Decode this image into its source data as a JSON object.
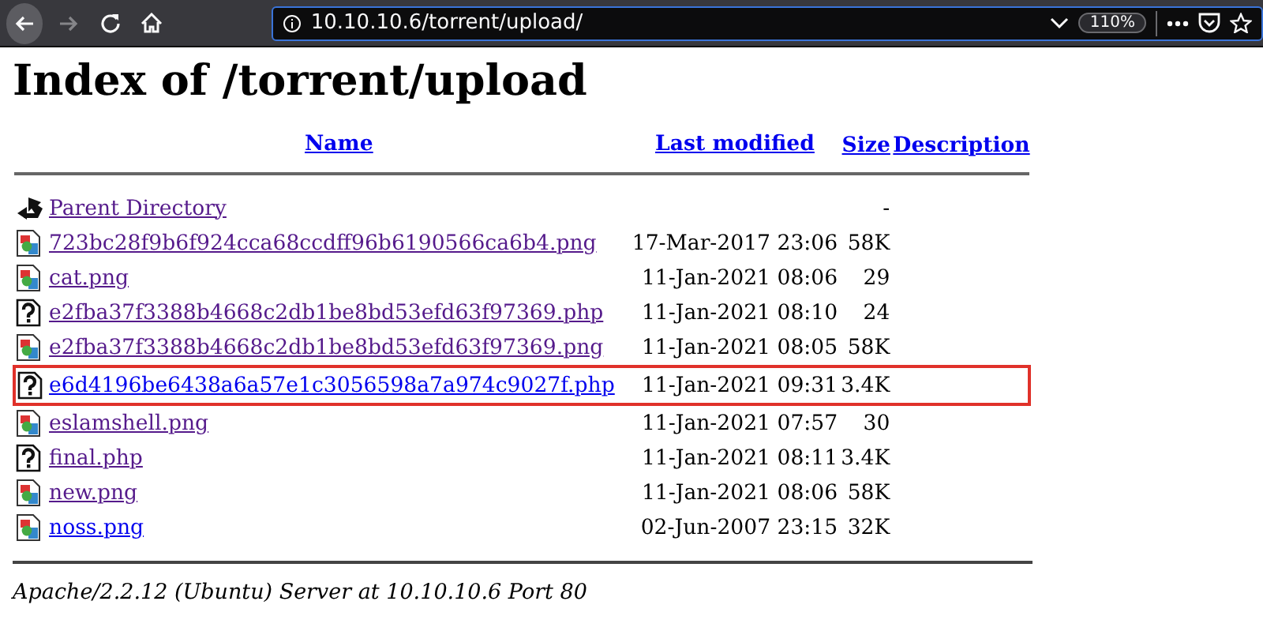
{
  "toolbar": {
    "back_enabled": true,
    "forward_enabled": false,
    "url": "10.10.10.6/torrent/upload/",
    "zoom": "110%"
  },
  "page": {
    "heading": "Index of /torrent/upload",
    "columns": [
      "Name",
      "Last modified",
      "Size",
      "Description"
    ],
    "rows": [
      {
        "kind": "parent",
        "name": "Parent Directory",
        "modified": "",
        "size": "-",
        "visited": true,
        "highlighted": false
      },
      {
        "kind": "image",
        "name": "723bc28f9b6f924cca68ccdff96b6190566ca6b4.png",
        "modified": "17-Mar-2017 23:06",
        "size": "58K",
        "visited": true,
        "highlighted": false
      },
      {
        "kind": "image",
        "name": "cat.png",
        "modified": "11-Jan-2021 08:06",
        "size": "29",
        "visited": true,
        "highlighted": false
      },
      {
        "kind": "unknown",
        "name": "e2fba37f3388b4668c2db1be8bd53efd63f97369.php",
        "modified": "11-Jan-2021 08:10",
        "size": "24",
        "visited": true,
        "highlighted": false
      },
      {
        "kind": "image",
        "name": "e2fba37f3388b4668c2db1be8bd53efd63f97369.png",
        "modified": "11-Jan-2021 08:05",
        "size": "58K",
        "visited": true,
        "highlighted": false
      },
      {
        "kind": "unknown",
        "name": "e6d4196be6438a6a57e1c3056598a7a974c9027f.php",
        "modified": "11-Jan-2021 09:31",
        "size": "3.4K",
        "visited": false,
        "highlighted": true
      },
      {
        "kind": "image",
        "name": "eslamshell.png",
        "modified": "11-Jan-2021 07:57",
        "size": "30",
        "visited": true,
        "highlighted": false
      },
      {
        "kind": "unknown",
        "name": "final.php",
        "modified": "11-Jan-2021 08:11",
        "size": "3.4K",
        "visited": true,
        "highlighted": false
      },
      {
        "kind": "image",
        "name": "new.png",
        "modified": "11-Jan-2021 08:06",
        "size": "58K",
        "visited": true,
        "highlighted": false
      },
      {
        "kind": "image",
        "name": "noss.png",
        "modified": "02-Jun-2007 23:15",
        "size": "32K",
        "visited": false,
        "highlighted": false
      }
    ],
    "footer": "Apache/2.2.12 (Ubuntu) Server at 10.10.10.6 Port 80"
  }
}
